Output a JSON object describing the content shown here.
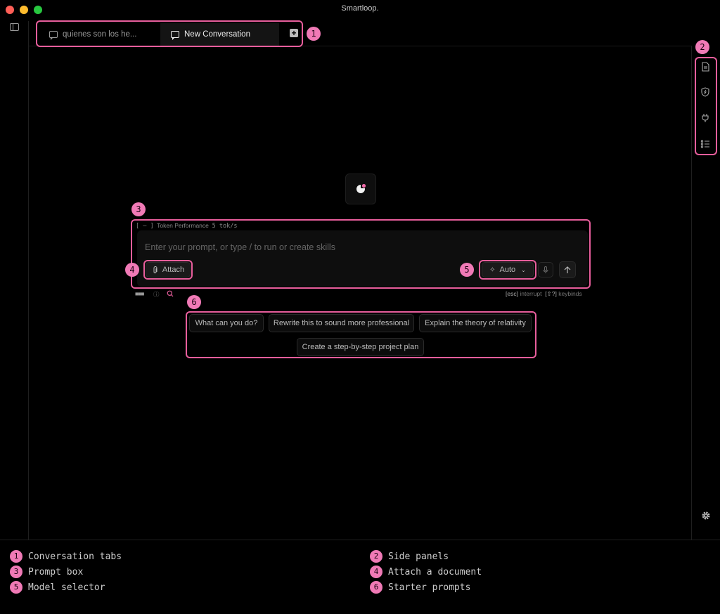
{
  "window": {
    "title": "Smartloop."
  },
  "tabs": [
    {
      "label": "quienes son los he...",
      "active": false
    },
    {
      "label": "New Conversation",
      "active": true
    }
  ],
  "prompt": {
    "collapse_marker": "[ – ]",
    "token_label": "Token Performance",
    "token_rate": "5 tok/s",
    "placeholder": "Enter your prompt, or type / to run or create skills",
    "attach_label": "Attach",
    "model_label": "Auto",
    "hint_interrupt_key": "[esc]",
    "hint_interrupt": "interrupt",
    "hint_keybinds_key": "[⇧?]",
    "hint_keybinds": "keybinds"
  },
  "starters": [
    "What can you do?",
    "Rewrite this to sound more professional",
    "Explain the theory of relativity",
    "Create a step-by-step project plan"
  ],
  "annotations": [
    {
      "num": "1",
      "label": "Conversation tabs"
    },
    {
      "num": "2",
      "label": "Side panels"
    },
    {
      "num": "3",
      "label": "Prompt box"
    },
    {
      "num": "4",
      "label": "Attach a document"
    },
    {
      "num": "5",
      "label": "Model selector"
    },
    {
      "num": "6",
      "label": "Starter prompts"
    }
  ],
  "side_panels": [
    "document-icon",
    "shield-bolt-icon",
    "plug-icon",
    "checklist-icon"
  ],
  "colors": {
    "accent": "#e85e9c",
    "badge": "#f07ab6",
    "background": "#000000"
  }
}
